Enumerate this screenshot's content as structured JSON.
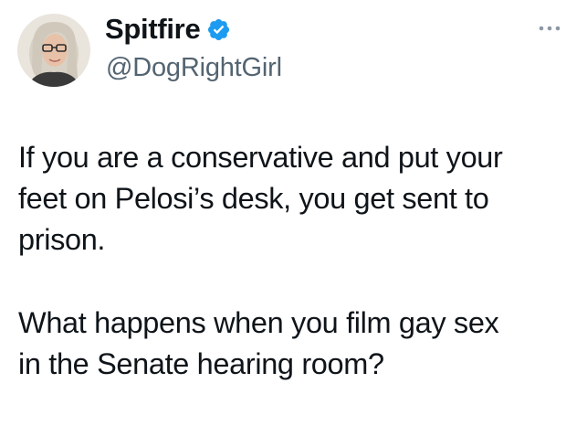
{
  "tweet": {
    "author": {
      "display_name": "Spitfire",
      "handle": "@DogRightGirl",
      "verified": true,
      "avatar_icon": "profile-photo",
      "verified_icon": "verified-badge-icon",
      "verified_color": "#1d9bf0"
    },
    "more_icon": "more-options-icon",
    "text": {
      "line_1": "If you are a conservative and put your",
      "line_2": "feet on Pelosi’s desk, you get sent to",
      "line_3": "prison.",
      "line_4": "What happens when you film gay sex",
      "line_5": "in the Senate hearing room?"
    }
  },
  "colors": {
    "text": "#0f1419",
    "secondary_text": "#536471",
    "accent": "#1d9bf0"
  }
}
